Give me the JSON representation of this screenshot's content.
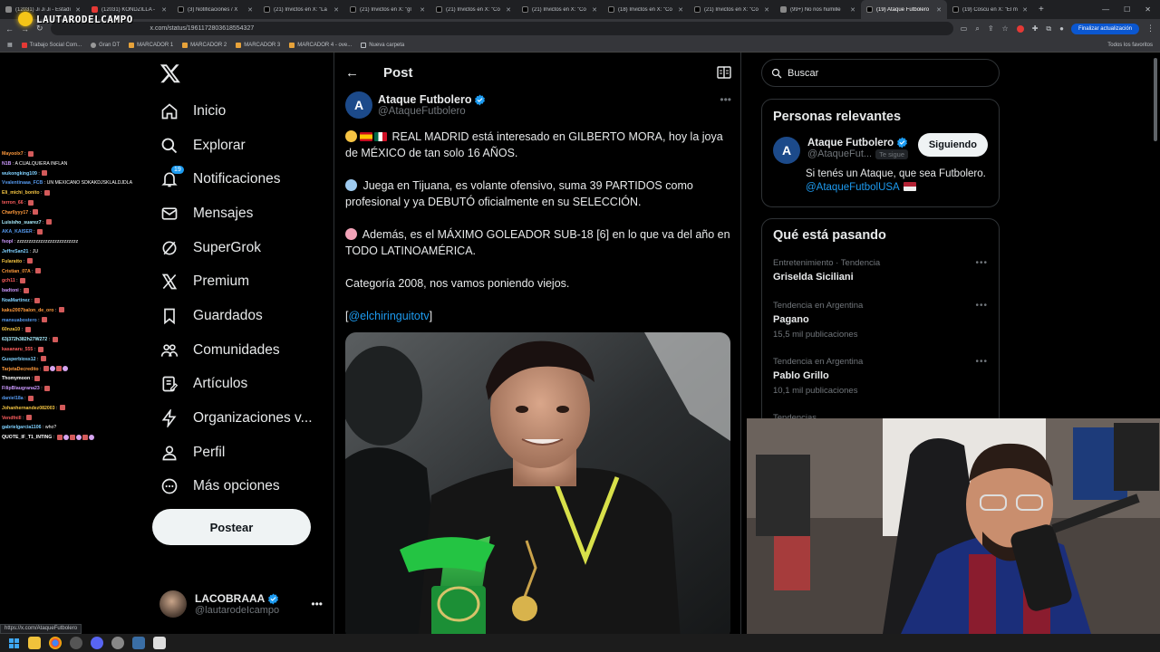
{
  "browser": {
    "tabs": [
      {
        "title": "(12031) Ji Ji Ji - Estadí",
        "icon": "generic"
      },
      {
        "title": "(12031) KONDZILLA -",
        "icon": "youtube"
      },
      {
        "title": "(3) Notificaciones / X",
        "icon": "x"
      },
      {
        "title": "(21) Invictos en X: \"La",
        "icon": "x"
      },
      {
        "title": "(21) Invictos en X: \"gl",
        "icon": "x"
      },
      {
        "title": "(21) Invictos en X: \"Co",
        "icon": "x"
      },
      {
        "title": "(21) Invictos en X: \"Co",
        "icon": "x"
      },
      {
        "title": "(18) Invictos en X: \"Co",
        "icon": "x"
      },
      {
        "title": "(21) Invictos en X: \"Co",
        "icon": "x"
      },
      {
        "title": "(99+) No nos humille",
        "icon": "tiktok"
      },
      {
        "title": "(19) Ataque Futbolero",
        "icon": "x",
        "active": true
      },
      {
        "title": "(19) Coscu en X: \"El m",
        "icon": "x"
      }
    ],
    "url": "x.com/status/1961172803618554327",
    "update_label": "Finalizar actualización",
    "bookmarks": [
      {
        "label": "Trabajo Social Com...",
        "icon": "red"
      },
      {
        "label": "Gran DT",
        "icon": "gray"
      },
      {
        "label": "MARCADOR 1",
        "icon": "gold"
      },
      {
        "label": "MARCADOR 2",
        "icon": "gold"
      },
      {
        "label": "MARCADOR 3",
        "icon": "gold"
      },
      {
        "label": "MARCADOR 4 - ove...",
        "icon": "gold"
      },
      {
        "label": "Nueva carpeta",
        "icon": "folder"
      }
    ],
    "all_bookmarks": "Todos los favoritos",
    "status_url": "https://x.com/AtaqueFutbolero"
  },
  "stream": {
    "channel_name": "LAUTARODELCAMPO",
    "chat": [
      {
        "user": "Mayoolx7",
        "color": "#ff9a3c",
        "msg": "",
        "emotes": 1
      },
      {
        "user": "N1B",
        "color": "#c9f",
        "msg": "A CUALQUIERA INFLAN",
        "emotes": 0
      },
      {
        "user": "wukongking109",
        "color": "#7fd1ff",
        "msg": "",
        "emotes": 1
      },
      {
        "user": "Vvalentinaaa_FCB",
        "color": "#59e",
        "msg": "UN MEXICANO SDKAKDJSKLALDJDLA",
        "emotes": 0
      },
      {
        "user": "Eli_michi_bonito",
        "color": "#f5c542",
        "msg": "",
        "emotes": 1
      },
      {
        "user": "terron_66",
        "color": "#ff5e5e",
        "msg": "",
        "emotes": 1
      },
      {
        "user": "Charllyyy17",
        "color": "#ff9a3c",
        "msg": "",
        "emotes": 1
      },
      {
        "user": "Luisisho_suarez7",
        "color": "#aef",
        "msg": "",
        "emotes": 1
      },
      {
        "user": "AKA_KAISER",
        "color": "#59e",
        "msg": "",
        "emotes": 1
      },
      {
        "user": "fsopl",
        "color": "#c9f",
        "msg": "zzzzzzzzzzzzzzzzzzzzzzzzzz",
        "emotes": 0
      },
      {
        "user": "JeffreSan21",
        "color": "#7fd1ff",
        "msg": "JU",
        "emotes": 0
      },
      {
        "user": "Fularatto",
        "color": "#f5c542",
        "msg": "",
        "emotes": 1
      },
      {
        "user": "Cristian_07A",
        "color": "#ff9a3c",
        "msg": "",
        "emotes": 1
      },
      {
        "user": "gch11",
        "color": "#ff5e5e",
        "msg": "",
        "emotes": 1
      },
      {
        "user": "badtoni",
        "color": "#c9f",
        "msg": "",
        "emotes": 1
      },
      {
        "user": "NoaMartinez",
        "color": "#7fd1ff",
        "msg": "",
        "emotes": 1
      },
      {
        "user": "kaku2007balon_de_oro",
        "color": "#ff9a3c",
        "msg": "",
        "emotes": 1
      },
      {
        "user": "mansuabostero",
        "color": "#59e",
        "msg": "",
        "emotes": 1
      },
      {
        "user": "60nza10",
        "color": "#f5c542",
        "msg": "",
        "emotes": 1
      },
      {
        "user": "63j372h382h27W272",
        "color": "#aef",
        "msg": "",
        "emotes": 1
      },
      {
        "user": "kasanaru_555",
        "color": "#ff5e5e",
        "msg": "",
        "emotes": 1
      },
      {
        "user": "Gusperbioss12",
        "color": "#7fd1ff",
        "msg": "",
        "emotes": 1
      },
      {
        "user": "TarjetaDecredito",
        "color": "#ff9a3c",
        "msg": "",
        "emotes": 4
      },
      {
        "user": "Thomymoon",
        "color": "#fff",
        "msg": "",
        "emotes": 1
      },
      {
        "user": "FilipBlaugrana23",
        "color": "#c9f",
        "msg": "",
        "emotes": 1
      },
      {
        "user": "daniel18a",
        "color": "#59e",
        "msg": "",
        "emotes": 1
      },
      {
        "user": "Johanhernandez082003",
        "color": "#f5c542",
        "msg": "",
        "emotes": 1
      },
      {
        "user": "Vendfnill",
        "color": "#ff5e5e",
        "msg": "",
        "emotes": 1
      },
      {
        "user": "gabrielgarcia1106",
        "color": "#7fd1ff",
        "msg": "who?",
        "emotes": 0
      },
      {
        "user": "QUOTE_IF_T1_INTING",
        "color": "#fff",
        "msg": "",
        "emotes": 6
      }
    ]
  },
  "sidebar": {
    "items": [
      {
        "label": "Inicio",
        "icon": "home-icon"
      },
      {
        "label": "Explorar",
        "icon": "search-icon"
      },
      {
        "label": "Notificaciones",
        "icon": "bell-icon",
        "badge": "19"
      },
      {
        "label": "Mensajes",
        "icon": "mail-icon"
      },
      {
        "label": "SuperGrok",
        "icon": "grok-icon"
      },
      {
        "label": "Premium",
        "icon": "x-premium-icon"
      },
      {
        "label": "Guardados",
        "icon": "bookmark-icon"
      },
      {
        "label": "Comunidades",
        "icon": "communities-icon"
      },
      {
        "label": "Artículos",
        "icon": "article-icon"
      },
      {
        "label": "Organizaciones v...",
        "icon": "lightning-icon"
      },
      {
        "label": "Perfil",
        "icon": "profile-icon"
      },
      {
        "label": "Más opciones",
        "icon": "more-circle-icon"
      }
    ],
    "post_button": "Postear",
    "account": {
      "name": "LACOBRAAA",
      "handle": "@lautarodeIcampo"
    }
  },
  "main": {
    "header_title": "Post",
    "author": {
      "name": "Ataque Futbolero",
      "handle": "@AtaqueFutbolero",
      "avatar_letter": "A"
    },
    "paragraphs": [
      "REAL MADRID está interesado en GILBERTO MORA, hoy la joya de MÉXICO de tan solo 16 AÑOS.",
      "Juega en Tijuana, es volante ofensivo, suma 39 PARTIDOS como profesional y ya DEBUTÓ oficialmente en su SELECCIÓN.",
      "Además, es el MÁXIMO GOLEADOR SUB-18 [6] en lo que va del año en TODO LATINOAMÉRICA.",
      "Categoría 2008, nos vamos poniendo viejos."
    ],
    "source_link": "@elchiringuitotv"
  },
  "right": {
    "search_placeholder": "Buscar",
    "relevant": {
      "title": "Personas relevantes",
      "name": "Ataque Futbolero",
      "handle": "@AtaqueFut...",
      "follows_you": "Te sigue",
      "follow_button": "Siguiendo",
      "bio": "Si tenés un Ataque, que sea Futbolero.",
      "bio_link": "@AtaqueFutbolUSA"
    },
    "trends_title": "Qué está pasando",
    "trends": [
      {
        "context": "Entretenimiento · Tendencia",
        "name": "Griselda Siciliani",
        "count": ""
      },
      {
        "context": "Tendencia en Argentina",
        "name": "Pagano",
        "count": "15,5 mil publicaciones"
      },
      {
        "context": "Tendencia en Argentina",
        "name": "Pablo Grillo",
        "count": "10,1 mil publicaciones"
      },
      {
        "context": "Tendencias",
        "name": "",
        "count": ""
      }
    ]
  },
  "colors": {
    "accent": "#1d9bf0",
    "background": "#000000",
    "text": "#e7e9ea",
    "secondary_text": "#71767b",
    "border": "#2f3336"
  }
}
